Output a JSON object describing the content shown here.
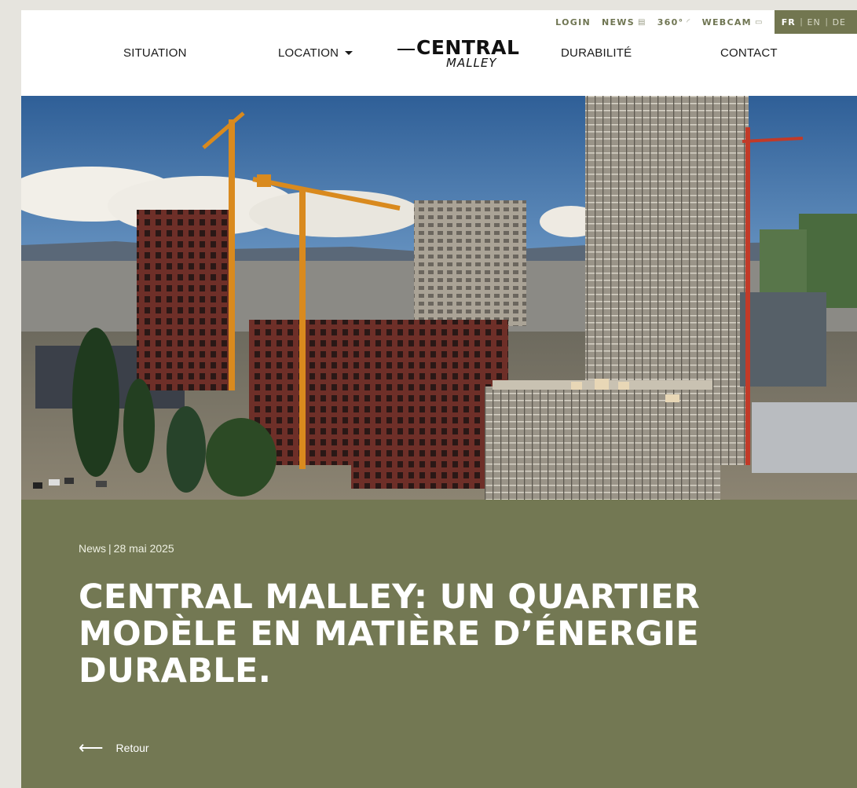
{
  "utility": {
    "login": "LOGIN",
    "news": "NEWS",
    "news_icon": "newspaper-icon",
    "tour": "360°",
    "tour_icon": "panorama-icon",
    "webcam": "WEBCAM",
    "webcam_icon": "camera-icon"
  },
  "languages": {
    "fr": "FR",
    "en": "EN",
    "de": "DE",
    "active": "FR",
    "active_color": "#727650"
  },
  "nav": {
    "situation": "SITUATION",
    "location": "LOCATION",
    "durabilite": "DURABILITÉ",
    "contact": "CONTACT"
  },
  "logo": {
    "main": "CENTRAL",
    "sub": "MALLEY"
  },
  "article": {
    "category": "News",
    "date": "28 mai 2025",
    "title": "CENTRAL MALLEY: UN QUARTIER MODÈLE EN MATIÈRE D’ÉNERGIE DURABLE.",
    "back_label": "Retour",
    "panel_color": "#737853"
  }
}
